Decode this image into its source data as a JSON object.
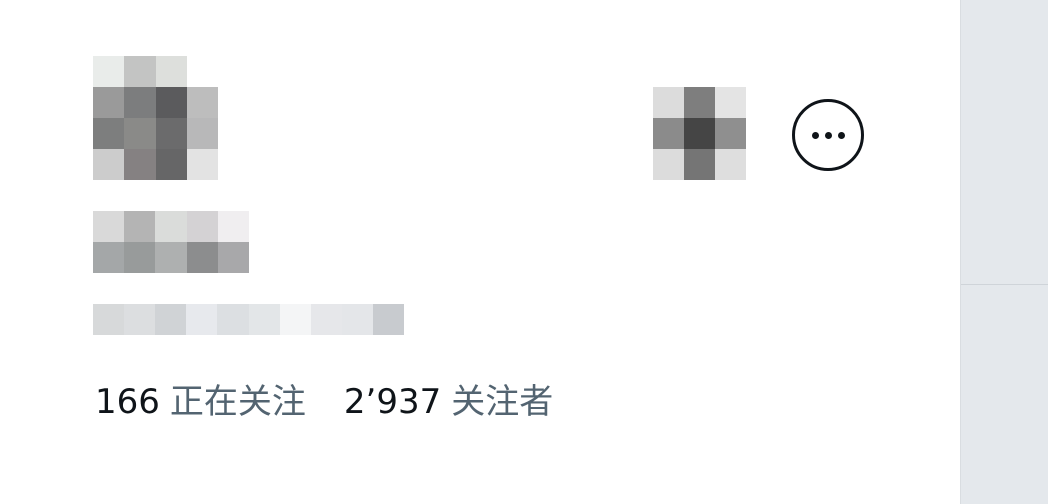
{
  "profile": {
    "more_button_icon": "more-horizontal-icon",
    "stats": {
      "following_count": "166",
      "following_label": "正在关注",
      "followers_count": "2’937",
      "followers_label": "关注者"
    }
  },
  "colors": {
    "text_primary": "#0f1419",
    "text_secondary": "#536471",
    "rail_background": "#e4e8ec"
  }
}
